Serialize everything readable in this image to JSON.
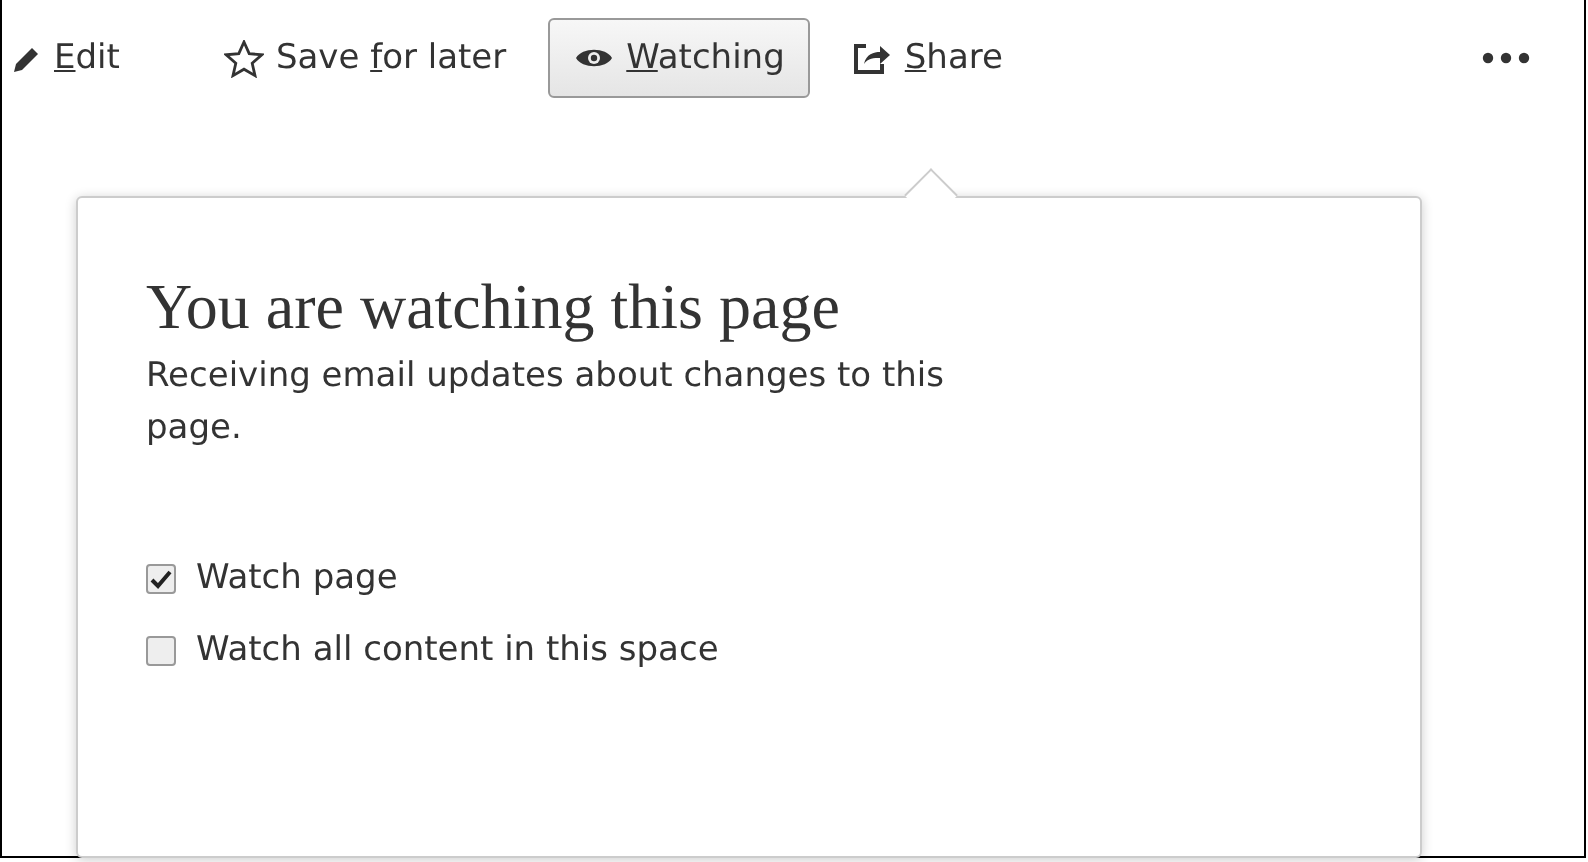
{
  "toolbar": [
    {
      "kind": "edit",
      "label": {
        "key": "E",
        "post": "dit"
      },
      "selected": false
    },
    {
      "kind": "save",
      "label": {
        "pre": "Save ",
        "key": "f",
        "post": "or later"
      },
      "selected": false
    },
    {
      "kind": "watch",
      "label": {
        "key": "W",
        "post": "atching"
      },
      "selected": true
    },
    {
      "kind": "share",
      "label": {
        "key": "S",
        "post": "hare"
      },
      "selected": false
    },
    {
      "kind": "more",
      "selected": false
    }
  ],
  "popup": {
    "title": "You are watching this page",
    "description": "Receiving email updates about changes to this page.",
    "options": [
      {
        "label": "Watch page",
        "checked": true
      },
      {
        "label": "Watch all content in this space",
        "checked": false
      }
    ]
  }
}
